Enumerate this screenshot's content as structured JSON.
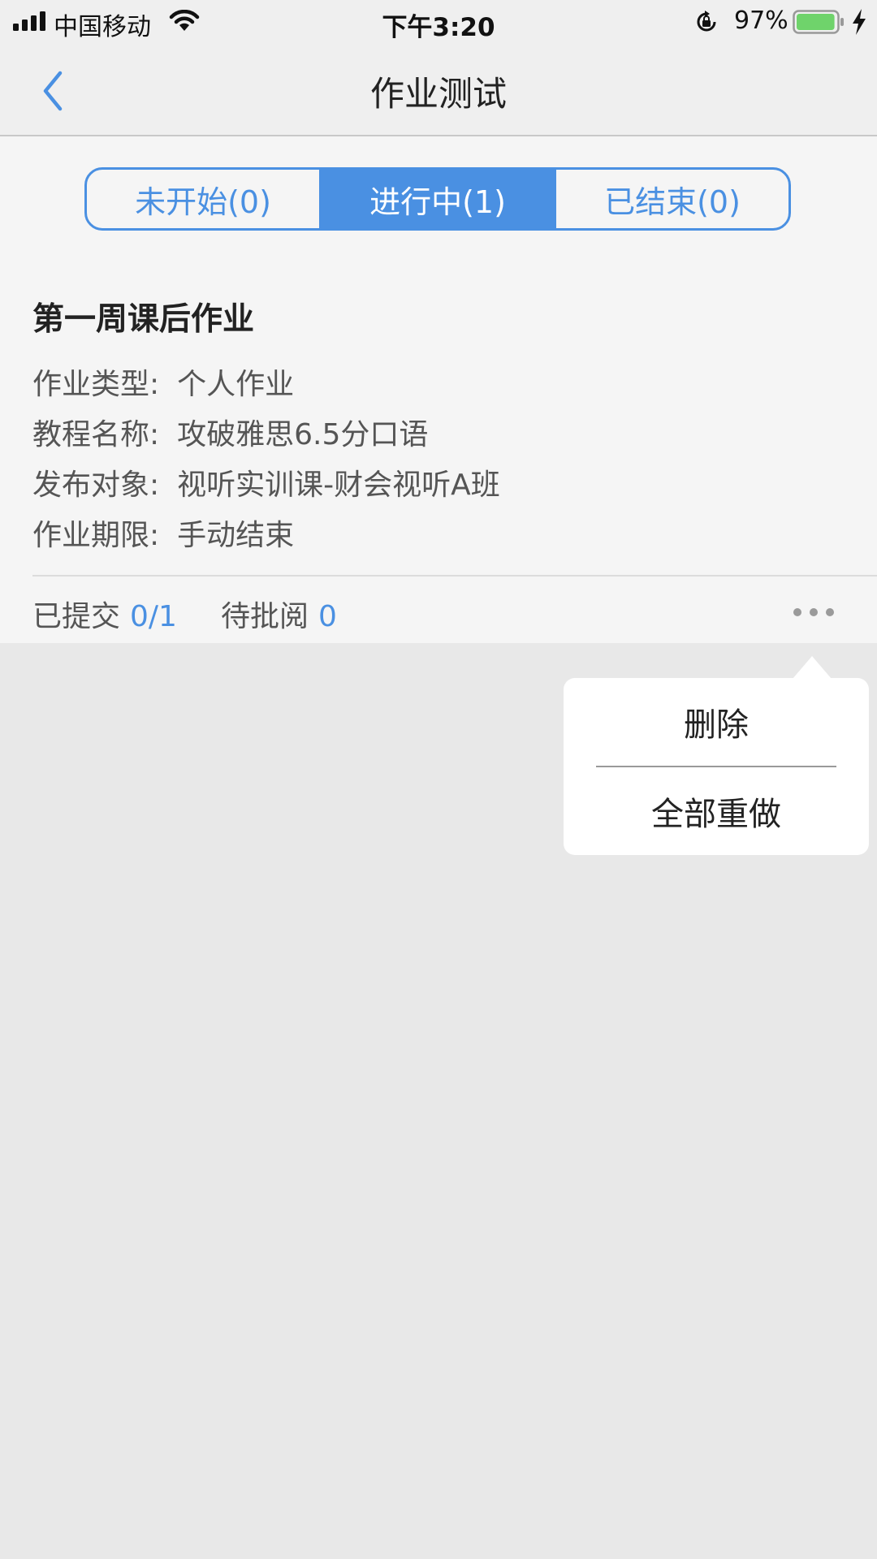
{
  "status_bar": {
    "carrier": "中国移动",
    "time": "下午3:20",
    "battery_percent": "97%",
    "battery_level": 0.97,
    "icons": [
      "signal-icon",
      "wifi-icon",
      "rotation-lock-icon",
      "battery-icon",
      "charging-bolt-icon"
    ]
  },
  "nav": {
    "title": "作业测试",
    "back_icon": "chevron-left-icon"
  },
  "tabs": [
    {
      "label": "未开始(0)",
      "active": false
    },
    {
      "label": "进行中(1)",
      "active": true
    },
    {
      "label": "已结束(0)",
      "active": false
    }
  ],
  "assignment": {
    "title": "第一周课后作业",
    "rows": [
      {
        "label": "作业类型:",
        "value": "个人作业"
      },
      {
        "label": "教程名称:",
        "value": "攻破雅思6.5分口语"
      },
      {
        "label": "发布对象:",
        "value": "视听实训课-财会视听A班"
      },
      {
        "label": "作业期限:",
        "value": "手动结束"
      }
    ],
    "stats": {
      "submitted_label": "已提交",
      "submitted_value": "0/1",
      "pending_label": "待批阅",
      "pending_value": "0"
    },
    "more_icon": "more-dots-icon"
  },
  "popup_menu": {
    "items": [
      "删除",
      "全部重做"
    ]
  },
  "colors": {
    "accent": "#4a90e2",
    "background": "#e8e8e8",
    "panel": "#f5f5f5",
    "battery_green": "#6fd36b"
  }
}
